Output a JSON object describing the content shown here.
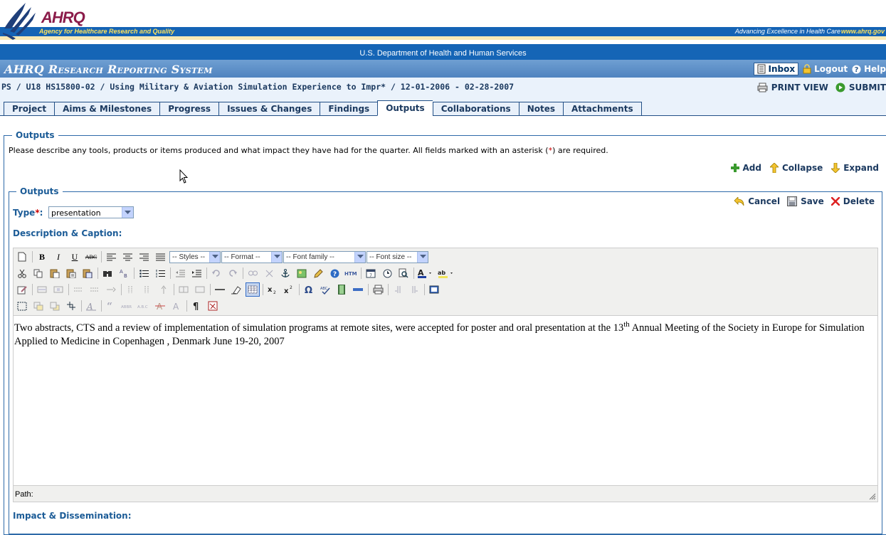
{
  "banner": {
    "logo_text": "AHRQ",
    "agency_name": "Agency for Healthcare Research and Quality",
    "tagline": "Advancing Excellence in Health Care",
    "url": "www.ahrq.gov"
  },
  "hhs_bar": {
    "text": "U.S. Department of Health and Human Services"
  },
  "header": {
    "system_title": "AHRQ Research Reporting System",
    "inbox_label": "Inbox",
    "logout_label": "Logout",
    "help_label": "Help"
  },
  "breadcrumb": {
    "text": "PS / U18 HS15800-02 / Using Military & Aviation Simulation Experience to Impr* / 12-01-2006 - 02-28-2007",
    "print_label": "PRINT VIEW",
    "submit_label": "SUBMIT"
  },
  "tabs": [
    {
      "label": "Project"
    },
    {
      "label": "Aims & Milestones"
    },
    {
      "label": "Progress"
    },
    {
      "label": "Issues & Changes"
    },
    {
      "label": "Findings"
    },
    {
      "label": "Outputs",
      "active": true
    },
    {
      "label": "Collaborations"
    },
    {
      "label": "Notes"
    },
    {
      "label": "Attachments"
    }
  ],
  "outputs_section": {
    "legend": "Outputs",
    "intro_before": "Please describe any tools, products or items produced and what impact they have had for the quarter. All fields marked with an asterisk (",
    "intro_asterisk": "*",
    "intro_after": ") are required.",
    "add_label": "Add",
    "collapse_label": "Collapse",
    "expand_label": "Expand"
  },
  "output_item": {
    "legend": "Outputs",
    "cancel_label": "Cancel",
    "save_label": "Save",
    "delete_label": "Delete",
    "type_label": "Type",
    "type_asterisk": "*",
    "type_colon": ":",
    "type_value": "presentation",
    "description_label": "Description & Caption:",
    "impact_label": "Impact & Dissemination:"
  },
  "editor": {
    "styles_select": "-- Styles --",
    "format_select": "-- Format --",
    "font_family_select": "-- Font family --",
    "font_size_select": "-- Font size --",
    "content_before": "Two abstracts, CTS and a review of implementation of simulation programs at remote sites, were accepted for poster and oral presentation at the 13",
    "content_sup": "th",
    "content_after": " Annual Meeting of the Society in Europe for Simulation Applied to Medicine in Copenhagen , Denmark June 19-20, 2007",
    "path_label": "Path:"
  },
  "colors": {
    "banner_blue": "#1463b5",
    "title_bar": "#5a8cc6",
    "label_blue": "#1c5c97",
    "required_red": "#cc0000"
  }
}
